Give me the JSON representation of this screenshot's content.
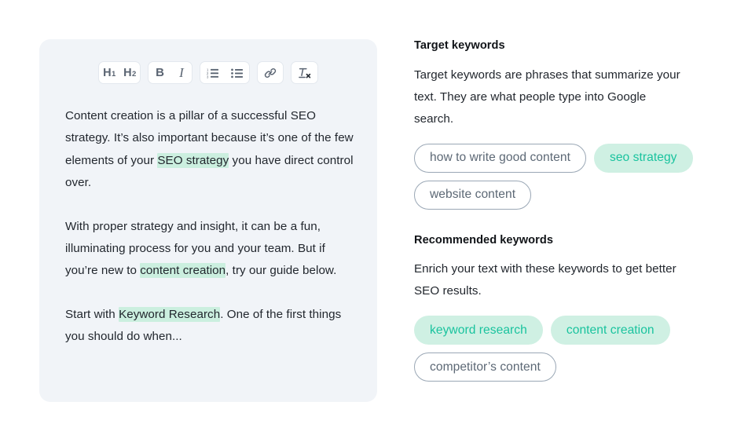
{
  "editor": {
    "toolbar": {
      "groups": [
        {
          "name": "headings",
          "buttons": [
            {
              "id": "h1",
              "label": "H",
              "sub": "1",
              "icon": "heading-1-icon"
            },
            {
              "id": "h2",
              "label": "H",
              "sub": "2",
              "icon": "heading-2-icon"
            }
          ]
        },
        {
          "name": "inline-format",
          "buttons": [
            {
              "id": "bold",
              "label": "B",
              "icon": "bold-icon"
            },
            {
              "id": "italic",
              "label": "I",
              "icon": "italic-icon"
            }
          ]
        },
        {
          "name": "lists",
          "buttons": [
            {
              "id": "ordered-list",
              "label": "",
              "icon": "ordered-list-icon"
            },
            {
              "id": "bullet-list",
              "label": "",
              "icon": "bullet-list-icon"
            }
          ]
        },
        {
          "name": "link",
          "buttons": [
            {
              "id": "link",
              "label": "",
              "icon": "link-icon"
            }
          ]
        },
        {
          "name": "clear-format",
          "buttons": [
            {
              "id": "clear-formatting",
              "label": "",
              "icon": "clear-formatting-icon"
            }
          ]
        }
      ]
    },
    "paragraphs": [
      {
        "runs": [
          {
            "text": "Content creation is a pillar of a successful SEO strategy. It’s also important because it’s one of the few elements of your ",
            "highlight": false
          },
          {
            "text": "SEO strategy",
            "highlight": true
          },
          {
            "text": " you have direct control over.",
            "highlight": false
          }
        ]
      },
      {
        "runs": [
          {
            "text": "With proper strategy and insight, it can be a fun, illuminating process for you and your team. But if you’re new to ",
            "highlight": false
          },
          {
            "text": "content creation",
            "highlight": true
          },
          {
            "text": ", try our guide below.",
            "highlight": false
          }
        ]
      },
      {
        "runs": [
          {
            "text": "Start with ",
            "highlight": false
          },
          {
            "text": "Keyword Research",
            "highlight": true
          },
          {
            "text": ". One of the first things you should do when...",
            "highlight": false
          }
        ]
      }
    ]
  },
  "panel": {
    "target": {
      "title": "Target keywords",
      "description": "Target keywords are phrases that summarize your text. They are what people type into Google search.",
      "chips": [
        {
          "label": "how to write good content",
          "style": "outline"
        },
        {
          "label": "seo strategy",
          "style": "filled"
        },
        {
          "label": "website content",
          "style": "outline"
        }
      ]
    },
    "recommended": {
      "title": "Recommended keywords",
      "description": "Enrich your text with these keywords to get better SEO results.",
      "chips": [
        {
          "label": "keyword research",
          "style": "filled"
        },
        {
          "label": "content creation",
          "style": "filled"
        },
        {
          "label": "competitor’s content",
          "style": "outline"
        }
      ]
    }
  },
  "colors": {
    "accent_teal": "#19C39E",
    "chip_fill": "#CFF0E3",
    "highlight": "#CBEFDF",
    "editor_bg": "#F1F4F8",
    "text_primary": "#22272E",
    "text_muted": "#5C6875",
    "chip_border": "#9AA7B5"
  }
}
